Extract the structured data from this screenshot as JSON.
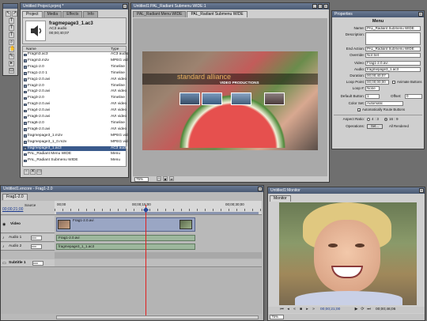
{
  "project": {
    "title": "Untitled Project.prproj *",
    "tabs": [
      "Project",
      "Media",
      "Effects",
      "Info"
    ],
    "preview": {
      "name": "fragmepage3_1.ac3",
      "type": "AC3 audio",
      "duration": "00;00;40;07"
    },
    "columns": [
      "Name",
      "Type"
    ],
    "items": [
      {
        "name": "Fragm3.ac3",
        "type": "AC3 audio"
      },
      {
        "name": "Fragm3.m2v",
        "type": "MPEG video"
      },
      {
        "name": "Frag1-2.0",
        "type": "Timeline"
      },
      {
        "name": "Frag1-2.0 1",
        "type": "Timeline"
      },
      {
        "name": "Frag1-2.0.avi",
        "type": "AVI video"
      },
      {
        "name": "Frag2-2.0",
        "type": "Timeline"
      },
      {
        "name": "Frag2-2.0.avi",
        "type": "AVI video"
      },
      {
        "name": "Frag3-2.0",
        "type": "Timeline"
      },
      {
        "name": "Frag3-2.0.avi",
        "type": "AVI video"
      },
      {
        "name": "Frag4-2.0.avi",
        "type": "AVI video"
      },
      {
        "name": "Frag5-2.0.avi",
        "type": "AVI video"
      },
      {
        "name": "Frag6-2.0",
        "type": "Timeline"
      },
      {
        "name": "Frag6-2.0.avi",
        "type": "AVI video"
      },
      {
        "name": "fragmepage3_1.m2v",
        "type": "MPEG video"
      },
      {
        "name": "fragmepage3_1_0.m2v",
        "type": "MPEG video"
      },
      {
        "name": "fragmepage3_1.ac3",
        "type": "AC3 audio"
      },
      {
        "name": "PAL_Radiant Menu WIDE",
        "type": "Menu"
      },
      {
        "name": "PAL_Radiant Submenu WIDE",
        "type": "Menu"
      }
    ],
    "selected_index": 15
  },
  "menu_editor": {
    "title": "Untitled1:PAL_Radiant Submenu WIDE:1",
    "tabs": [
      "PAL_Radiant Menu WIDE",
      "PAL_Radiant Submenu WIDE"
    ],
    "brand_line1": "standard alliance",
    "brand_line2": "VIDEO PRODUCTIONS",
    "zoom": "75%"
  },
  "properties": {
    "title": "Properties",
    "section": "Menu",
    "rows": [
      {
        "label": "Name:",
        "value": "PAL_Radiant Submenu WIDE"
      },
      {
        "label": "Description:",
        "value": ""
      },
      {
        "label": "End Action:",
        "value": "PAL_Radiant Submenu WIDE"
      },
      {
        "label": "Override:",
        "value": "Not Set"
      },
      {
        "label": "Video:",
        "value": "Frag1-2.0.avi"
      },
      {
        "label": "Audio:",
        "value": "fragmepage3_1.ac3"
      },
      {
        "label": "Duration:",
        "value": "00;00;40;07"
      },
      {
        "label": "Loop Point:",
        "value": "00;00;00;00"
      },
      {
        "label": "Loop #:",
        "value": "None"
      },
      {
        "label": "Default Button:",
        "value": "1"
      },
      {
        "label": "Color Set:",
        "value": "Automatic"
      }
    ],
    "animate_buttons": "Animate Buttons",
    "offset_label": "Offset:",
    "offset_value": "0",
    "auto_route": "Automatically Route Buttons",
    "aspect_label": "Aspect Ratio:",
    "aspect_4_3": "4 : 3",
    "aspect_16_9": "16 : 9",
    "operations_label": "Operations:",
    "operations_value": "Set...",
    "all_rendered": "All Rendered"
  },
  "timeline": {
    "title": "Untitled1.encore - Frag1-2.0",
    "tab": "Frag1-2.0",
    "timecode_label": "Source",
    "timecode": "00;00;21;00",
    "ruler": [
      "00;00",
      "00;00;15;00",
      "00;00;30;00"
    ],
    "tracks": {
      "video": "Video",
      "audio1": "Audio 1",
      "audio2": "Audio 2",
      "subtitle": "Subtitle 1"
    },
    "clips": {
      "video": "Frag1-2.0.avi",
      "audio1": "Frag1-2.0.avi",
      "audio2": "fragmepage3_1_1.ac3"
    },
    "lang": "xxx",
    "playhead_fraction": 0.44
  },
  "monitor": {
    "title": "Untitled1:Monitor",
    "tab": "Monitor",
    "timecode_current": "00;00;21;00",
    "timecode_total": "00;00;46;06",
    "zoom": "75%"
  },
  "colors": {
    "accent": "#3a5a8c",
    "playhead": "#e02020",
    "video_clip": "#9aa6c4",
    "audio_clip": "#9db79d"
  }
}
